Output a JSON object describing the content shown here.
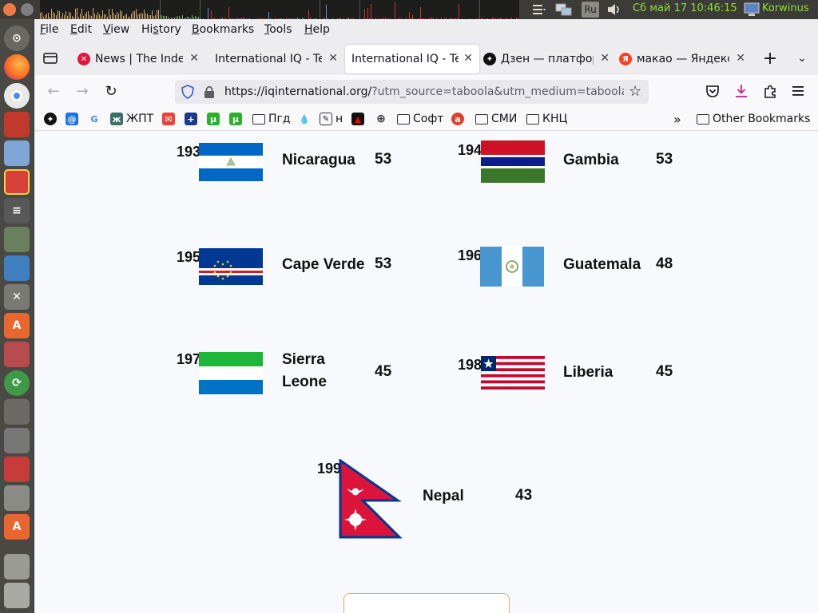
{
  "system": {
    "keyboard_layout": "Ru",
    "clock": "Сб май 17 10:46:15",
    "username": "Korwinus"
  },
  "menubar": {
    "items": [
      "File",
      "Edit",
      "View",
      "History",
      "Bookmarks",
      "Tools",
      "Help"
    ],
    "underlined": [
      "F",
      "E",
      "V",
      "s",
      "B",
      "T",
      "H"
    ]
  },
  "tabs": [
    {
      "title": "News | The Independent",
      "favicon": "independent-icon",
      "active": false
    },
    {
      "title": "International IQ - Te",
      "favicon": "",
      "active": false
    },
    {
      "title": "International IQ - Te",
      "favicon": "",
      "active": true
    },
    {
      "title": "Дзен — платформа",
      "favicon": "dzen-icon",
      "active": false
    },
    {
      "title": "макао — Яндекс",
      "favicon": "yandex-icon",
      "active": false
    }
  ],
  "navbar": {
    "url_host": "https://iqinternational.org/",
    "url_rest": "?utm_source=taboola&utm_medium=taboola&"
  },
  "bookmarks": {
    "items": [
      "ЖПТ",
      "н",
      "Пгд",
      "Софт",
      "СМИ",
      "КНЦ"
    ],
    "other": "Other Bookmarks"
  },
  "rankings": [
    {
      "rank": "193",
      "country": "Nicaragua",
      "score": "53",
      "flag": "nicaragua-flag"
    },
    {
      "rank": "194",
      "country": "Gambia",
      "score": "53",
      "flag": "gambia-flag"
    },
    {
      "rank": "195",
      "country": "Cape Verde",
      "score": "53",
      "flag": "cape-verde-flag"
    },
    {
      "rank": "196",
      "country": "Guatemala",
      "score": "48",
      "flag": "guatemala-flag"
    },
    {
      "rank": "197",
      "country": "Sierra Leone",
      "score": "45",
      "flag": "sierra-leone-flag"
    },
    {
      "rank": "198",
      "country": "Liberia",
      "score": "45",
      "flag": "liberia-flag"
    },
    {
      "rank": "199",
      "country": "Nepal",
      "score": "43",
      "flag": "nepal-flag"
    }
  ],
  "colors": {
    "accent_orange": "#e8a560",
    "clock_green": "#8ae234",
    "panel": "#3c3b37",
    "launcher": "#4a4843"
  }
}
